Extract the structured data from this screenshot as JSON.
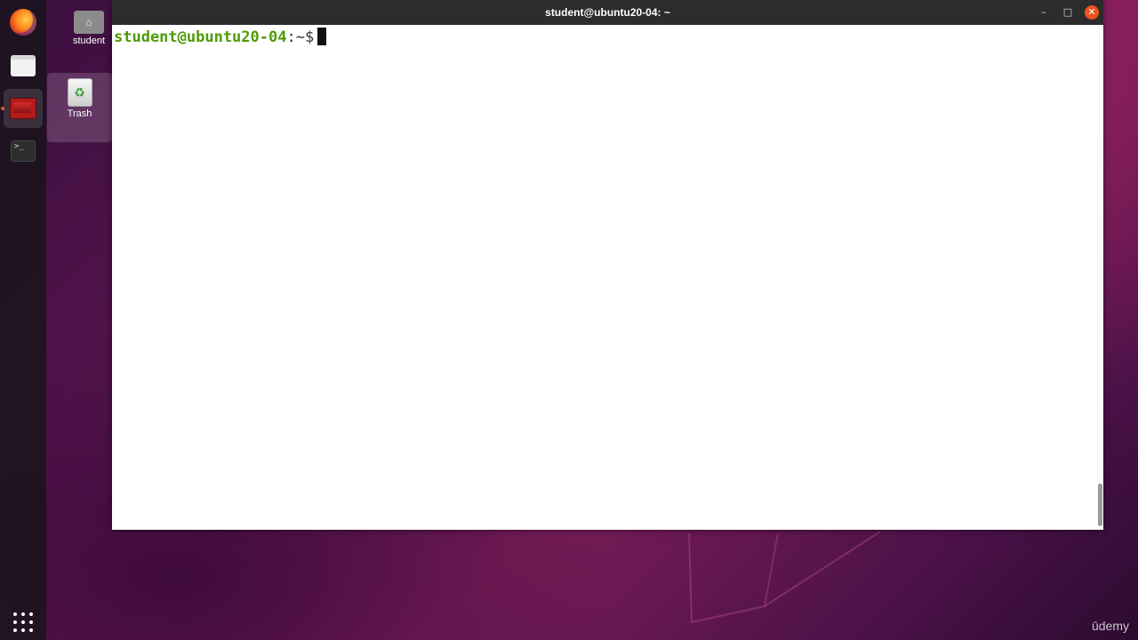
{
  "window": {
    "title": "student@ubuntu20-04: ~",
    "minimize_glyph": "–",
    "maximize_glyph": "□",
    "close_glyph": "✕"
  },
  "terminal": {
    "prompt_user_host": "student@ubuntu20-04",
    "prompt_path": ":~$",
    "input_value": ""
  },
  "desktop": {
    "icons": [
      {
        "label": "student",
        "icon": "home-folder-icon"
      },
      {
        "label": "Trash",
        "icon": "trash-icon"
      }
    ]
  },
  "dock": {
    "items": [
      {
        "icon": "firefox-icon"
      },
      {
        "icon": "files-icon"
      },
      {
        "icon": "app-icon",
        "active": true
      },
      {
        "icon": "terminal-icon"
      }
    ],
    "terminal_glyph": ">_",
    "show_apps_icon": "grid-icon"
  },
  "watermark": "ūdemy",
  "colors": {
    "prompt_green": "#4e9a06",
    "close_button": "#e95420"
  }
}
